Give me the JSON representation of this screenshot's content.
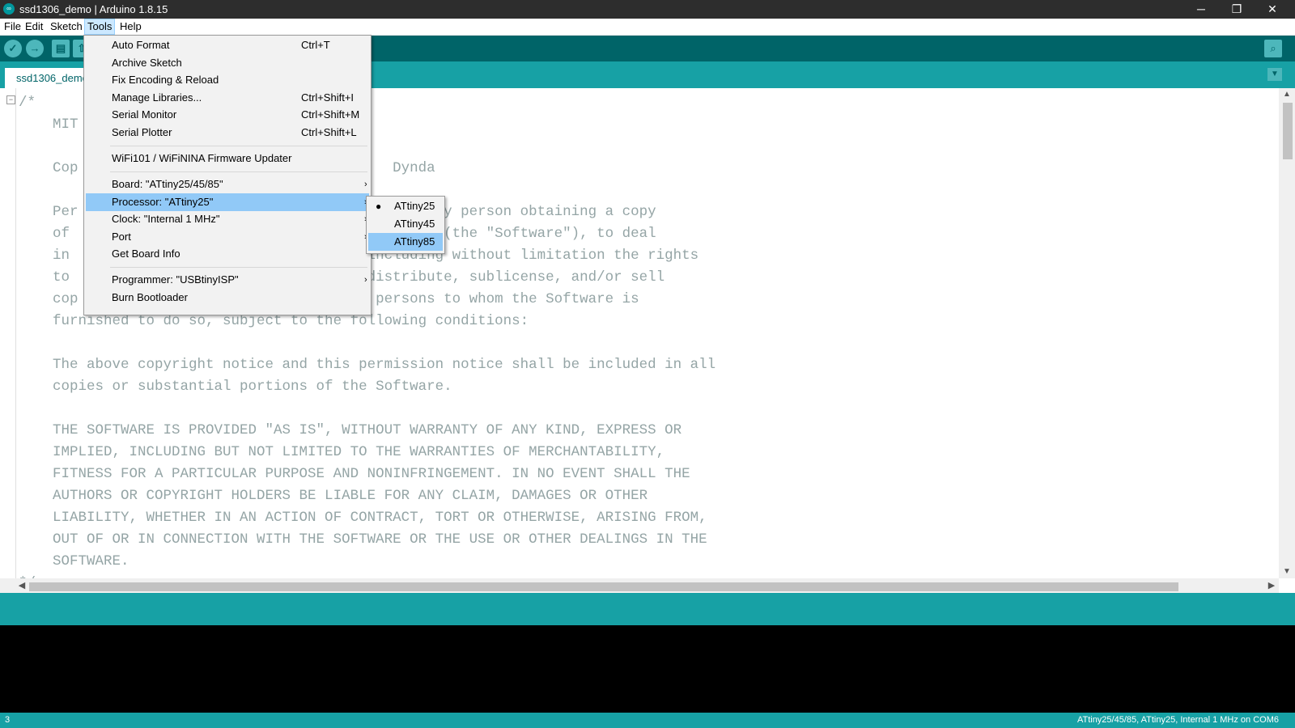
{
  "window": {
    "title": "ssd1306_demo | Arduino 1.8.15",
    "app_icon": "arduino-icon",
    "controls": {
      "minimize": "─",
      "restore": "❐",
      "close": "✕"
    }
  },
  "menubar": [
    "File",
    "Edit",
    "Sketch",
    "Tools",
    "Help"
  ],
  "toolbar": {
    "verify": "✓",
    "upload": "→",
    "new": "▤",
    "open": "⇧",
    "serial_monitor": "⌕"
  },
  "tab": {
    "label": "ssd1306_demo",
    "menu_arrow": "▼"
  },
  "tools_menu": {
    "auto_format": {
      "label": "Auto Format",
      "shortcut": "Ctrl+T"
    },
    "archive_sketch": {
      "label": "Archive Sketch"
    },
    "fix_encoding": {
      "label": "Fix Encoding & Reload"
    },
    "manage_libraries": {
      "label": "Manage Libraries...",
      "shortcut": "Ctrl+Shift+I"
    },
    "serial_monitor": {
      "label": "Serial Monitor",
      "shortcut": "Ctrl+Shift+M"
    },
    "serial_plotter": {
      "label": "Serial Plotter",
      "shortcut": "Ctrl+Shift+L"
    },
    "wifi_updater": {
      "label": "WiFi101 / WiFiNINA Firmware Updater"
    },
    "board": {
      "label": "Board: \"ATtiny25/45/85\""
    },
    "processor": {
      "label": "Processor: \"ATtiny25\""
    },
    "clock": {
      "label": "Clock: \"Internal 1 MHz\""
    },
    "port": {
      "label": "Port"
    },
    "board_info": {
      "label": "Get Board Info"
    },
    "programmer": {
      "label": "Programmer: \"USBtinyISP\""
    },
    "burn_bootloader": {
      "label": "Burn Bootloader"
    },
    "submenu_arrow": "›"
  },
  "processor_submenu": {
    "items": [
      "ATtiny25",
      "ATtiny45",
      "ATtiny85"
    ],
    "selected": "ATtiny25",
    "highlighted": "ATtiny85",
    "bullet": "●"
  },
  "editor": {
    "fold_marker": "−",
    "lines": [
      "/*",
      "    MIT",
      "",
      "    Cop                                     Dynda",
      "",
      "    Per                                arge, to any person obtaining a copy",
      "    of                                ation files (the \"Software\"), to deal",
      "    in                              ion, including without limitation the rights",
      "    to                             lish, distribute, sublicense, and/or sell",
      "    cop                             ermit persons to whom the Software is",
      "    furnished to do so, subject to the following conditions:",
      "",
      "    The above copyright notice and this permission notice shall be included in all",
      "    copies or substantial portions of the Software.",
      "",
      "    THE SOFTWARE IS PROVIDED \"AS IS\", WITHOUT WARRANTY OF ANY KIND, EXPRESS OR",
      "    IMPLIED, INCLUDING BUT NOT LIMITED TO THE WARRANTIES OF MERCHANTABILITY,",
      "    FITNESS FOR A PARTICULAR PURPOSE AND NONINFRINGEMENT. IN NO EVENT SHALL THE",
      "    AUTHORS OR COPYRIGHT HOLDERS BE LIABLE FOR ANY CLAIM, DAMAGES OR OTHER",
      "    LIABILITY, WHETHER IN AN ACTION OF CONTRACT, TORT OR OTHERWISE, ARISING FROM,",
      "    OUT OF OR IN CONNECTION WITH THE SOFTWARE OR THE USE OR OTHER DEALINGS IN THE",
      "    SOFTWARE.",
      "*/"
    ]
  },
  "scroll": {
    "up": "▲",
    "down": "▼",
    "left": "◀",
    "right": "▶"
  },
  "statusbar": {
    "line_number": "3",
    "board_info": "ATtiny25/45/85, ATtiny25, Internal 1 MHz on COM6"
  }
}
